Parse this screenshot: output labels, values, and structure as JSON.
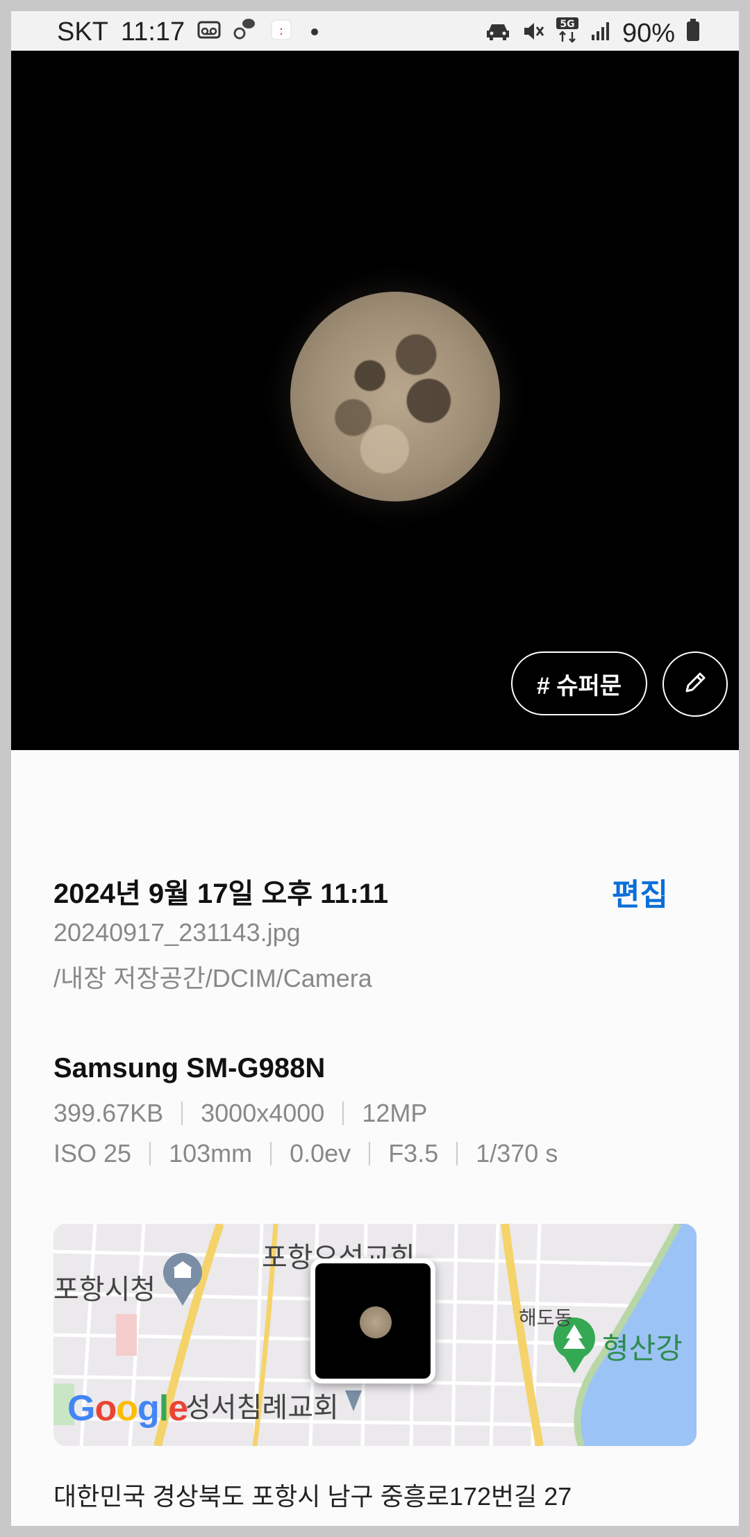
{
  "status_bar": {
    "carrier": "SKT",
    "time": "11:17",
    "network": "5G",
    "battery": "90%"
  },
  "photo": {
    "tag_label": "# 슈퍼문"
  },
  "details": {
    "date": "2024년 9월 17일 오후 11:11",
    "edit_label": "편집",
    "filename": "20240917_231143.jpg",
    "path": "/내장 저장공간/DCIM/Camera",
    "device": "Samsung SM-G988N",
    "file_specs": [
      "399.67KB",
      "3000x4000",
      "12MP"
    ],
    "camera_specs": [
      "ISO 25",
      "103mm",
      "0.0ev",
      "F3.5",
      "1/370 s"
    ]
  },
  "map": {
    "labels": {
      "city_hall": "포항시청",
      "church_top": "포항오성교회",
      "church_bottom": "성서침례교회",
      "district": "해도동",
      "river": "형산강"
    },
    "logo": "Google"
  },
  "address": "대한민국 경상북도 포항시 남구 중흥로172번길 27",
  "colors": {
    "accent": "#0a6fd8",
    "water": "#9cc3f5",
    "road": "#f5d36b"
  }
}
